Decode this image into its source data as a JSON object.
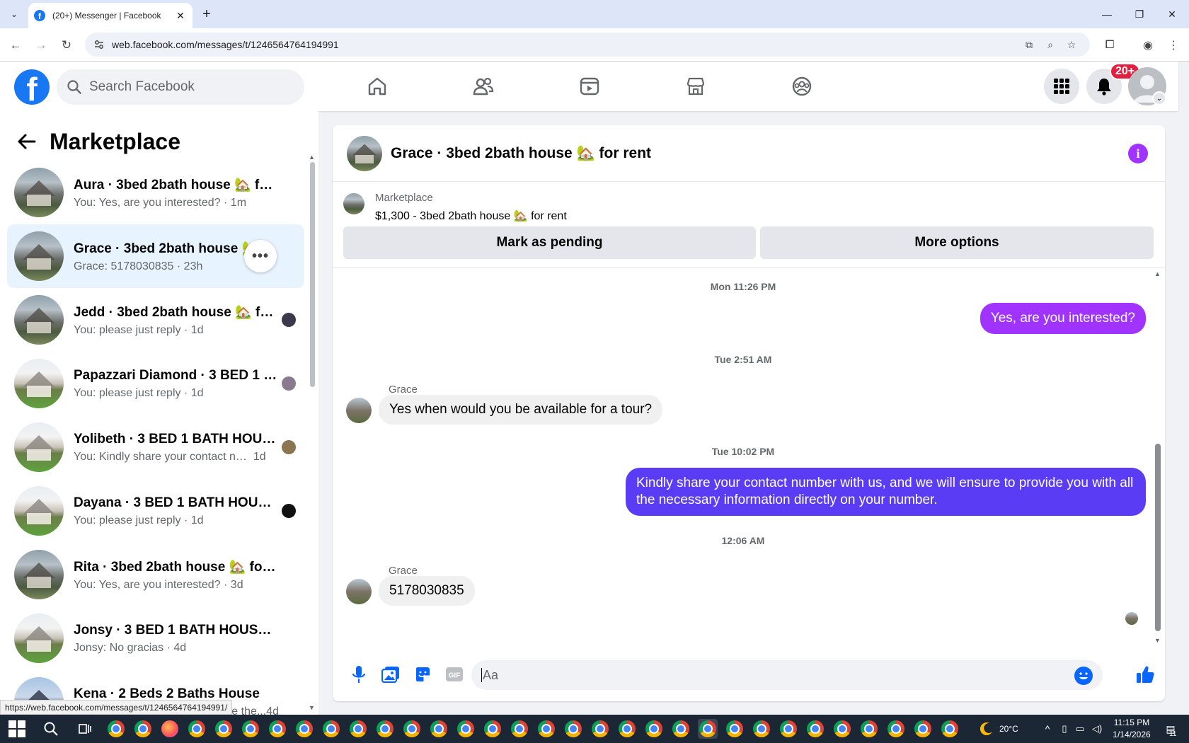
{
  "browser": {
    "tab_title": "(20+) Messenger | Facebook",
    "url": "web.facebook.com/messages/t/1246564764194991",
    "status_url": "https://web.facebook.com/messages/t/1246564764194991/"
  },
  "fb": {
    "search_placeholder": "Search Facebook",
    "notif_badge": "20+"
  },
  "sidebar": {
    "title": "Marketplace",
    "conversations": [
      {
        "name": "Aura · 3bed 2bath house 🏡 for r...",
        "snippet": "You: Yes, are you interested?",
        "time": "1m",
        "thumb": "house-a"
      },
      {
        "name": "Grace · 3bed 2bath house 🏡 fo...",
        "snippet": "Grace: 5178030835",
        "time": "23h",
        "thumb": "house-a"
      },
      {
        "name": "Jedd · 3bed 2bath house 🏡 fo...",
        "snippet": "You: please just reply",
        "time": "1d",
        "thumb": "house-a"
      },
      {
        "name": "Papazzari Diamond · 3 BED 1 B...",
        "snippet": "You: please just reply",
        "time": "1d",
        "thumb": "house-b"
      },
      {
        "name": "Yolibeth · 3 BED 1 BATH HOUS...",
        "snippet": "You: Kindly share your contact nu...",
        "time": "1d",
        "thumb": "house-b"
      },
      {
        "name": "Dayana · 3 BED 1 BATH HOUSE...",
        "snippet": "You: please just reply",
        "time": "1d",
        "thumb": "house-b"
      },
      {
        "name": "Rita · 3bed 2bath house 🏡 for r...",
        "snippet": "You: Yes, are you interested?",
        "time": "3d",
        "thumb": "house-a"
      },
      {
        "name": "Jonsy · 3 BED 1 BATH HOUSE AV...",
        "snippet": "Jonsy: No gracias",
        "time": "4d",
        "thumb": "house-b"
      },
      {
        "name": "Kena · 2 Beds 2 Baths House",
        "snippet": "...e the...",
        "time": "4d",
        "thumb": "house-c"
      }
    ]
  },
  "chat": {
    "title": "Grace · 3bed 2bath house 🏡 for rent",
    "listing_label": "Marketplace",
    "listing_title": "$1,300 - 3bed 2bath house 🏡 for rent",
    "mark_pending": "Mark as pending",
    "more_options": "More options",
    "messages": {
      "ts1": "Mon 11:26 PM",
      "out1": "Yes, are you interested?",
      "ts2": "Tue 2:51 AM",
      "sender1": "Grace",
      "in1": "Yes when  would you be available for a tour?",
      "ts3": "Tue 10:02 PM",
      "out2": "Kindly share your contact number with us, and we will ensure to provide you with all the necessary information directly on your number.",
      "ts4": "12:06 AM",
      "sender2": "Grace",
      "in2": "5178030835"
    },
    "composer_placeholder": "Aa"
  },
  "colors": {
    "fb_blue": "#1877f2",
    "bubble_out_1": "#a033ff",
    "bubble_out_2": "#5b3cf5",
    "active_conv": "#e7f3ff",
    "messenger_blue": "#0866ff"
  },
  "taskbar": {
    "temperature": "20°C",
    "time": "11:15 PM",
    "date": "1/14/2026",
    "notif_count": "11"
  }
}
